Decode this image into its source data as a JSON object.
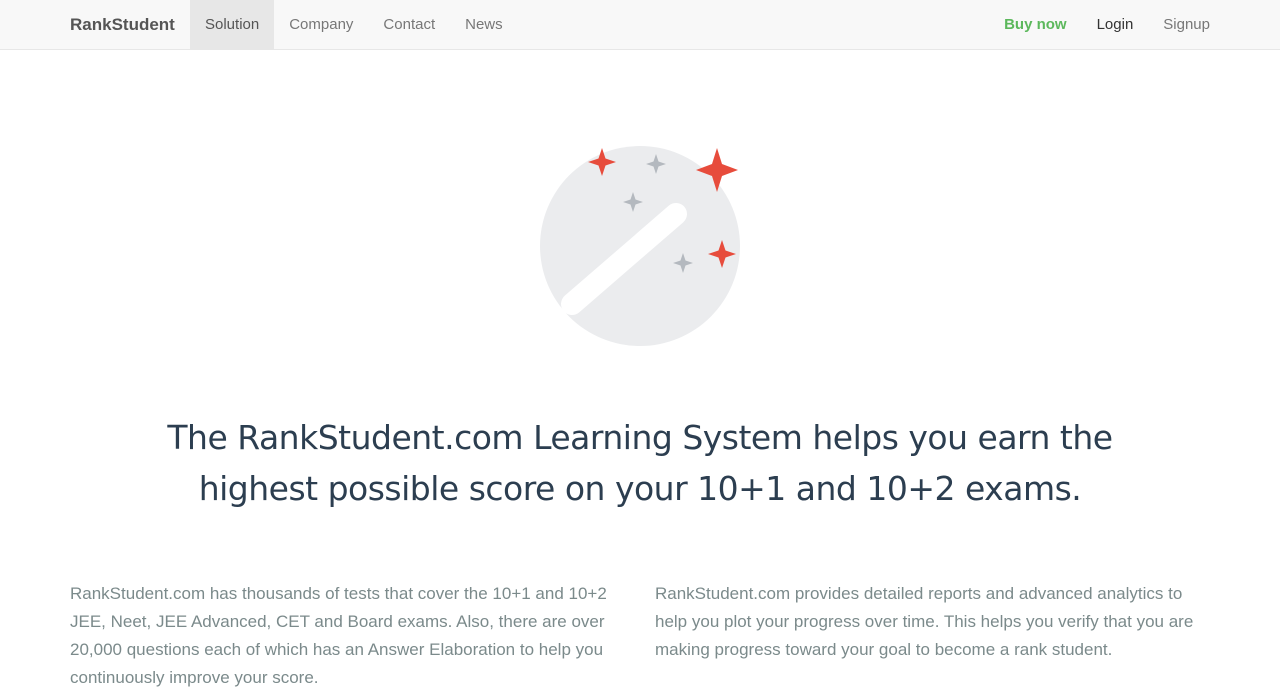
{
  "navbar": {
    "brand": "RankStudent",
    "left_items": [
      {
        "label": "Solution",
        "active": true
      },
      {
        "label": "Company",
        "active": false
      },
      {
        "label": "Contact",
        "active": false
      },
      {
        "label": "News",
        "active": false
      }
    ],
    "right_items": {
      "buy": "Buy now",
      "login": "Login",
      "signup": "Signup"
    }
  },
  "hero": {
    "icon": "magic-wand-sparkles-icon",
    "accent_color": "#e74c3c",
    "circle_color": "#ebecee",
    "sparkle_grey": "#b4b9bf"
  },
  "headline": {
    "line1": "The RankStudent.com Learning System helps you earn the",
    "line2": "highest possible score on your 10+1 and 10+2 exams."
  },
  "features": {
    "left": "RankStudent.com has thousands of tests that cover the 10+1 and 10+2 JEE, Neet, JEE Advanced, CET and Board exams. Also, there are over 20,000 questions each of which has an Answer Elaboration to help you continuously improve your score.",
    "right": "RankStudent.com provides detailed reports and advanced analytics to help you plot your progress over time. This helps you verify that you are making progress toward your goal to become a rank student."
  }
}
